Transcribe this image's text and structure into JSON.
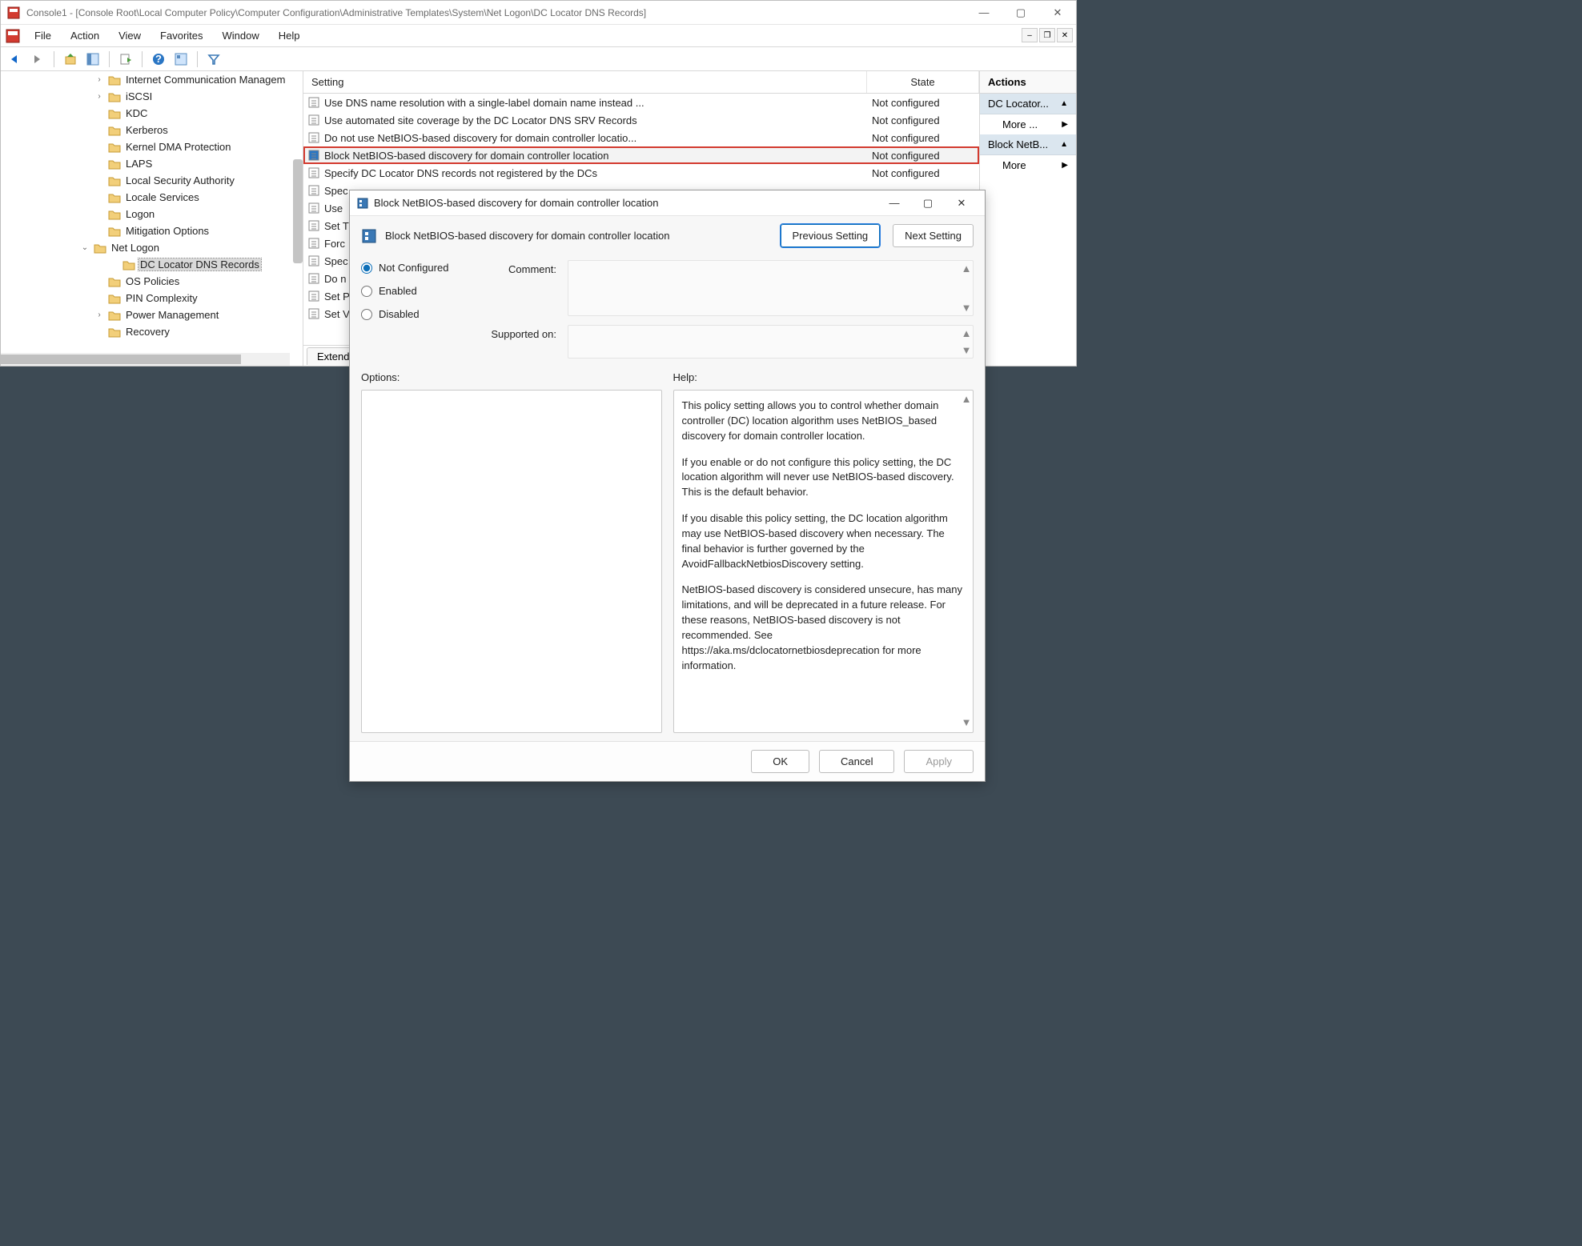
{
  "window": {
    "title": "Console1 - [Console Root\\Local Computer Policy\\Computer Configuration\\Administrative Templates\\System\\Net Logon\\DC Locator DNS Records]"
  },
  "menubar": {
    "file": "File",
    "action": "Action",
    "view": "View",
    "favorites": "Favorites",
    "window": "Window",
    "help": "Help"
  },
  "tree": {
    "items": [
      {
        "indent": 2,
        "exp": "›",
        "label": "Internet Communication Managem"
      },
      {
        "indent": 2,
        "exp": "›",
        "label": "iSCSI"
      },
      {
        "indent": 2,
        "exp": "",
        "label": "KDC"
      },
      {
        "indent": 2,
        "exp": "",
        "label": "Kerberos"
      },
      {
        "indent": 2,
        "exp": "",
        "label": "Kernel DMA Protection"
      },
      {
        "indent": 2,
        "exp": "",
        "label": "LAPS"
      },
      {
        "indent": 2,
        "exp": "",
        "label": "Local Security Authority"
      },
      {
        "indent": 2,
        "exp": "",
        "label": "Locale Services"
      },
      {
        "indent": 2,
        "exp": "",
        "label": "Logon"
      },
      {
        "indent": 2,
        "exp": "",
        "label": "Mitigation Options"
      },
      {
        "indent": 1,
        "exp": "⌄",
        "label": "Net Logon"
      },
      {
        "indent": 3,
        "exp": "",
        "label": "DC Locator DNS Records",
        "selected": true
      },
      {
        "indent": 2,
        "exp": "",
        "label": "OS Policies"
      },
      {
        "indent": 2,
        "exp": "",
        "label": "PIN Complexity"
      },
      {
        "indent": 2,
        "exp": "›",
        "label": "Power Management"
      },
      {
        "indent": 2,
        "exp": "",
        "label": "Recovery"
      }
    ]
  },
  "columns": {
    "setting": "Setting",
    "state": "State"
  },
  "rows": [
    {
      "label": "Use DNS name resolution with a single-label domain name instead ...",
      "state": "Not configured"
    },
    {
      "label": "Use automated site coverage by the DC Locator DNS SRV Records",
      "state": "Not configured"
    },
    {
      "label": "Do not use NetBIOS-based discovery for domain controller locatio...",
      "state": "Not configured"
    },
    {
      "label": "Block NetBIOS-based discovery for domain controller location",
      "state": "Not configured",
      "hl": true
    },
    {
      "label": "Specify DC Locator DNS records not registered by the DCs",
      "state": "Not configured"
    },
    {
      "label": "Spec",
      "state": ""
    },
    {
      "label": "Use",
      "state": ""
    },
    {
      "label": "Set T",
      "state": ""
    },
    {
      "label": "Forc",
      "state": ""
    },
    {
      "label": "Spec",
      "state": ""
    },
    {
      "label": "Do n",
      "state": ""
    },
    {
      "label": "Set P",
      "state": ""
    },
    {
      "label": "Set V",
      "state": ""
    }
  ],
  "tabs": {
    "extended": "Extended"
  },
  "actions": {
    "header": "Actions",
    "g1": "DC Locator...",
    "more": "More ...",
    "g2": "Block NetB...",
    "more2": "More"
  },
  "dialog": {
    "title": "Block NetBIOS-based discovery for domain controller location",
    "name": "Block NetBIOS-based discovery for domain controller location",
    "prev": "Previous Setting",
    "next": "Next Setting",
    "nc": "Not Configured",
    "en": "Enabled",
    "dis": "Disabled",
    "comment": "Comment:",
    "supported": "Supported on:",
    "options": "Options:",
    "help": "Help:",
    "help_p1": "This policy setting allows you to control whether domain controller (DC) location algorithm uses NetBIOS_based discovery for domain controller location.",
    "help_p2": "If you enable or do not configure this policy setting, the DC location algorithm will never use NetBIOS-based discovery. This is the default behavior.",
    "help_p3": "If you disable this policy setting, the DC location algorithm may use NetBIOS-based discovery when necessary. The final behavior is further governed by the AvoidFallbackNetbiosDiscovery setting.",
    "help_p4": "NetBIOS-based discovery is considered unsecure, has many limitations, and will be deprecated in a future release. For these reasons, NetBIOS-based discovery is not recommended. See https://aka.ms/dclocatornetbiosdeprecation for more information.",
    "ok": "OK",
    "cancel": "Cancel",
    "apply": "Apply"
  }
}
